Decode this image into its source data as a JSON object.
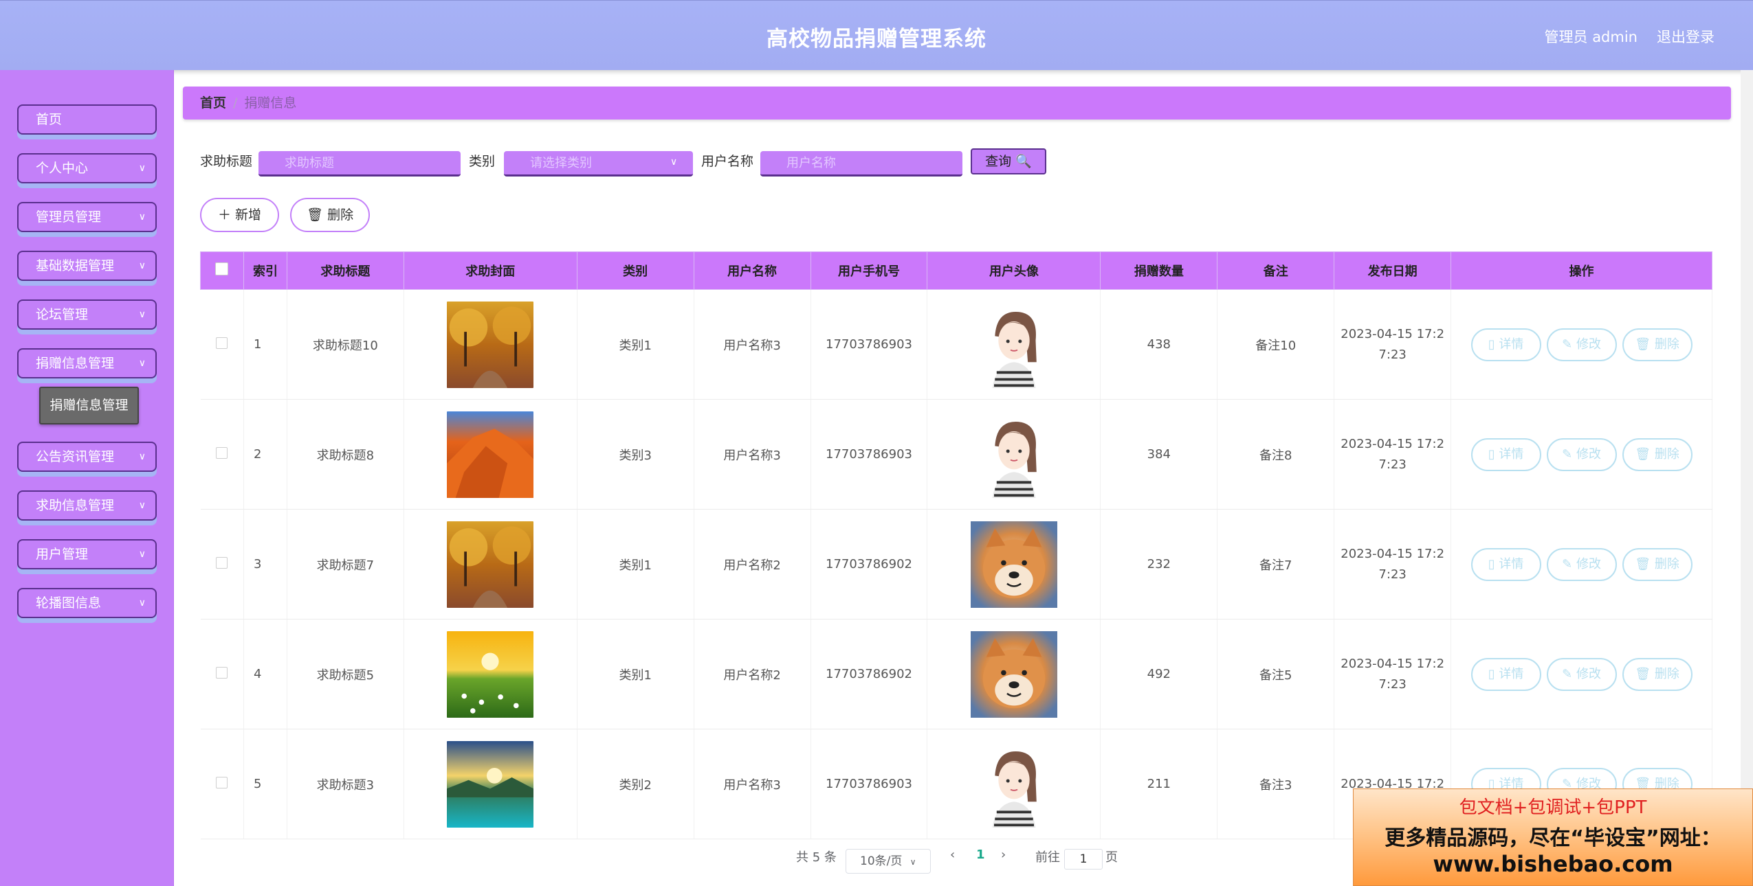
{
  "header": {
    "title": "高校物品捐赠管理系统",
    "user": "管理员 admin",
    "logout": "退出登录"
  },
  "sidebar": {
    "items": [
      {
        "label": "首页"
      },
      {
        "label": "个人中心"
      },
      {
        "label": "管理员管理"
      },
      {
        "label": "基础数据管理"
      },
      {
        "label": "论坛管理"
      },
      {
        "label": "捐赠信息管理"
      },
      {
        "label": "公告资讯管理"
      },
      {
        "label": "求助信息管理"
      },
      {
        "label": "用户管理"
      },
      {
        "label": "轮播图信息"
      }
    ],
    "sub_item": "捐赠信息管理"
  },
  "breadcrumb": {
    "home": "首页",
    "sep": "/",
    "current": "捐赠信息"
  },
  "search": {
    "title_label": "求助标题",
    "title_placeholder": "求助标题",
    "type_label": "类别",
    "type_placeholder": "请选择类别",
    "user_label": "用户名称",
    "user_placeholder": "用户名称",
    "query": "查询 🔍"
  },
  "actions": {
    "add": "＋ 新增",
    "delete": "🗑 删除"
  },
  "table": {
    "headers": [
      "索引",
      "求助标题",
      "求助封面",
      "类别",
      "用户名称",
      "用户手机号",
      "用户头像",
      "捐赠数量",
      "备注",
      "发布日期",
      "操作"
    ],
    "rows": [
      {
        "index": "1",
        "title": "求助标题10",
        "cover": "autumn",
        "type": "类别1",
        "user": "用户名称3",
        "phone": "17703786903",
        "avatar": "girl",
        "qty": "438",
        "note": "备注10",
        "date1": "2023-04-15 17:2",
        "date2": "7:23"
      },
      {
        "index": "2",
        "title": "求助标题8",
        "cover": "desert",
        "type": "类别3",
        "user": "用户名称3",
        "phone": "17703786903",
        "avatar": "girl",
        "qty": "384",
        "note": "备注8",
        "date1": "2023-04-15 17:2",
        "date2": "7:23"
      },
      {
        "index": "3",
        "title": "求助标题7",
        "cover": "autumn",
        "type": "类别1",
        "user": "用户名称2",
        "phone": "17703786902",
        "avatar": "dog",
        "qty": "232",
        "note": "备注7",
        "date1": "2023-04-15 17:2",
        "date2": "7:23"
      },
      {
        "index": "4",
        "title": "求助标题5",
        "cover": "meadow",
        "type": "类别1",
        "user": "用户名称2",
        "phone": "17703786902",
        "avatar": "dog",
        "qty": "492",
        "note": "备注5",
        "date1": "2023-04-15 17:2",
        "date2": "7:23"
      },
      {
        "index": "5",
        "title": "求助标题3",
        "cover": "lake",
        "type": "类别2",
        "user": "用户名称3",
        "phone": "17703786903",
        "avatar": "girl",
        "qty": "211",
        "note": "备注3",
        "date1": "2023-04-15 17:2",
        "date2": ""
      }
    ],
    "ops": {
      "detail": "▯ 详情",
      "edit": "✎ 修改",
      "delete": "🗑 删除"
    }
  },
  "pagination": {
    "total": "共 5 条",
    "size": "10条/页",
    "prev": "‹",
    "page": "1",
    "next": "›",
    "goto": "前往",
    "goto_value": "1",
    "unit": "页"
  },
  "promo": {
    "line1": "包文档+包调试+包PPT",
    "line2": "更多精品源码，尽在“毕设宝”网址：",
    "line3": "www.bishebao.com"
  },
  "colors": {
    "header": "#a7b2f6",
    "sidebar": "#c380f9",
    "accent": "#cb78fb",
    "op_border": "#b8e0f0"
  }
}
